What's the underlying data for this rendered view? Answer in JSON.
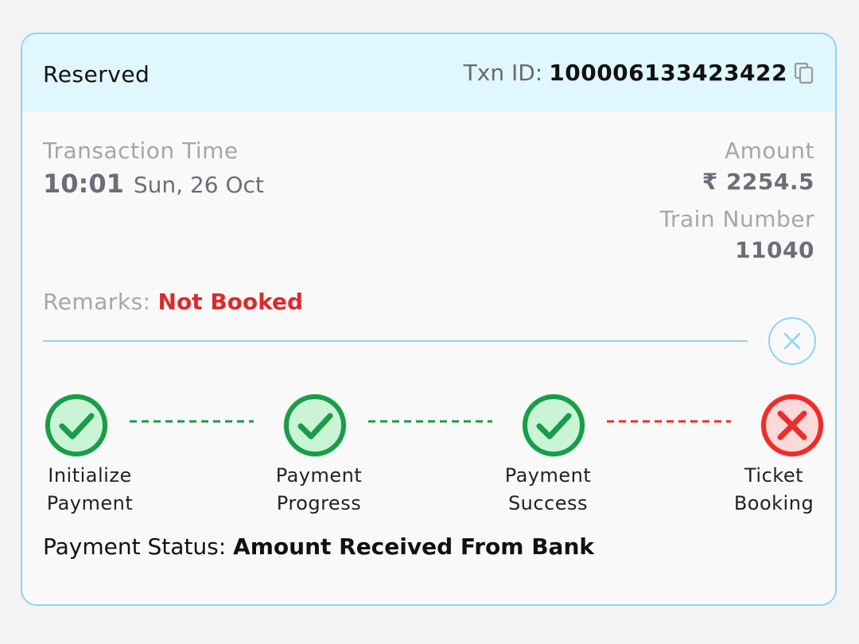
{
  "header": {
    "status": "Reserved",
    "txn_label": "Txn ID:",
    "txn_id": "100006133423422"
  },
  "transaction": {
    "time_label": "Transaction Time",
    "time": "10:01",
    "date": "Sun, 26 Oct",
    "amount_label": "Amount",
    "amount": "₹ 2254.5",
    "train_number_label": "Train Number",
    "train_number": "11040"
  },
  "remarks": {
    "label": "Remarks:",
    "value": "Not Booked"
  },
  "steps": [
    {
      "line1": "Initialize",
      "line2": "Payment",
      "state": "success",
      "icon": "check-icon"
    },
    {
      "line1": "Payment",
      "line2": "Progress",
      "state": "success",
      "icon": "check-icon"
    },
    {
      "line1": "Payment",
      "line2": "Success",
      "state": "success",
      "icon": "check-icon"
    },
    {
      "line1": "Ticket",
      "line2": "Booking",
      "state": "failed",
      "icon": "cross-icon"
    }
  ],
  "payment_status": {
    "label": "Payment Status:",
    "value": "Amount Received From Bank"
  },
  "colors": {
    "accent_border": "#8fd4f3",
    "header_bg": "#e0f7fe",
    "success": "#1a9c48",
    "success_fill": "#c9f5d6",
    "failed": "#ee2c2c",
    "failed_fill": "#fcd9d9",
    "remarks_red": "#dd2a2a"
  }
}
